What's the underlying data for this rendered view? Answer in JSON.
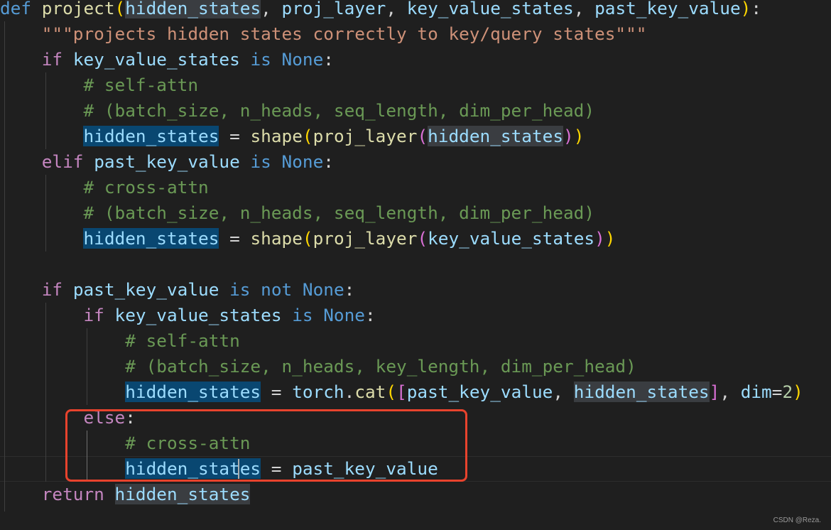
{
  "colors": {
    "background": "#1f1f1f",
    "keyword": "#c586c0",
    "storage": "#569cd6",
    "function": "#dcdcaa",
    "variable": "#9cdcfe",
    "string": "#ce9178",
    "comment": "#6a9955",
    "number": "#b5cea8",
    "plain": "#d4d4d4",
    "bracket1": "#ffd700",
    "bracket2": "#da70d6",
    "annotation_box": "#e8432d",
    "word_highlight": "#094771",
    "bracket_match_highlight": "#3a3d41"
  },
  "code": {
    "lines": [
      [
        {
          "t": "def",
          "c": "storage"
        },
        {
          "t": " ",
          "c": "plain"
        },
        {
          "t": "project",
          "c": "function"
        },
        {
          "t": "(",
          "c": "bracket1"
        },
        {
          "t": "hidden_states",
          "c": "variable",
          "hl": "match"
        },
        {
          "t": ", ",
          "c": "plain"
        },
        {
          "t": "proj_layer",
          "c": "variable"
        },
        {
          "t": ", ",
          "c": "plain"
        },
        {
          "t": "key_value_states",
          "c": "variable"
        },
        {
          "t": ", ",
          "c": "plain"
        },
        {
          "t": "past_key_value",
          "c": "variable"
        },
        {
          "t": ")",
          "c": "bracket1"
        },
        {
          "t": ":",
          "c": "plain"
        }
      ],
      [
        {
          "t": "    ",
          "c": "plain"
        },
        {
          "t": "\"\"\"projects hidden states correctly to key/query states\"\"\"",
          "c": "string"
        }
      ],
      [
        {
          "t": "    ",
          "c": "plain"
        },
        {
          "t": "if",
          "c": "keyword"
        },
        {
          "t": " ",
          "c": "plain"
        },
        {
          "t": "key_value_states",
          "c": "variable"
        },
        {
          "t": " ",
          "c": "plain"
        },
        {
          "t": "is",
          "c": "storage"
        },
        {
          "t": " ",
          "c": "plain"
        },
        {
          "t": "None",
          "c": "storage"
        },
        {
          "t": ":",
          "c": "plain"
        }
      ],
      [
        {
          "t": "        ",
          "c": "plain"
        },
        {
          "t": "# self-attn",
          "c": "comment"
        }
      ],
      [
        {
          "t": "        ",
          "c": "plain"
        },
        {
          "t": "# (batch_size, n_heads, seq_length, dim_per_head)",
          "c": "comment"
        }
      ],
      [
        {
          "t": "        ",
          "c": "plain"
        },
        {
          "t": "hidden_states",
          "c": "variable",
          "hl": "word"
        },
        {
          "t": " = ",
          "c": "plain"
        },
        {
          "t": "shape",
          "c": "function"
        },
        {
          "t": "(",
          "c": "bracket1"
        },
        {
          "t": "proj_layer",
          "c": "function"
        },
        {
          "t": "(",
          "c": "bracket2"
        },
        {
          "t": "hidden_states",
          "c": "variable",
          "hl": "match"
        },
        {
          "t": ")",
          "c": "bracket2"
        },
        {
          "t": ")",
          "c": "bracket1"
        }
      ],
      [
        {
          "t": "    ",
          "c": "plain"
        },
        {
          "t": "elif",
          "c": "keyword"
        },
        {
          "t": " ",
          "c": "plain"
        },
        {
          "t": "past_key_value",
          "c": "variable"
        },
        {
          "t": " ",
          "c": "plain"
        },
        {
          "t": "is",
          "c": "storage"
        },
        {
          "t": " ",
          "c": "plain"
        },
        {
          "t": "None",
          "c": "storage"
        },
        {
          "t": ":",
          "c": "plain"
        }
      ],
      [
        {
          "t": "        ",
          "c": "plain"
        },
        {
          "t": "# cross-attn",
          "c": "comment"
        }
      ],
      [
        {
          "t": "        ",
          "c": "plain"
        },
        {
          "t": "# (batch_size, n_heads, seq_length, dim_per_head)",
          "c": "comment"
        }
      ],
      [
        {
          "t": "        ",
          "c": "plain"
        },
        {
          "t": "hidden_states",
          "c": "variable",
          "hl": "word"
        },
        {
          "t": " = ",
          "c": "plain"
        },
        {
          "t": "shape",
          "c": "function"
        },
        {
          "t": "(",
          "c": "bracket1"
        },
        {
          "t": "proj_layer",
          "c": "function"
        },
        {
          "t": "(",
          "c": "bracket2"
        },
        {
          "t": "key_value_states",
          "c": "variable"
        },
        {
          "t": ")",
          "c": "bracket2"
        },
        {
          "t": ")",
          "c": "bracket1"
        }
      ],
      [],
      [
        {
          "t": "    ",
          "c": "plain"
        },
        {
          "t": "if",
          "c": "keyword"
        },
        {
          "t": " ",
          "c": "plain"
        },
        {
          "t": "past_key_value",
          "c": "variable"
        },
        {
          "t": " ",
          "c": "plain"
        },
        {
          "t": "is",
          "c": "storage"
        },
        {
          "t": " ",
          "c": "plain"
        },
        {
          "t": "not",
          "c": "storage"
        },
        {
          "t": " ",
          "c": "plain"
        },
        {
          "t": "None",
          "c": "storage"
        },
        {
          "t": ":",
          "c": "plain"
        }
      ],
      [
        {
          "t": "        ",
          "c": "plain"
        },
        {
          "t": "if",
          "c": "keyword"
        },
        {
          "t": " ",
          "c": "plain"
        },
        {
          "t": "key_value_states",
          "c": "variable"
        },
        {
          "t": " ",
          "c": "plain"
        },
        {
          "t": "is",
          "c": "storage"
        },
        {
          "t": " ",
          "c": "plain"
        },
        {
          "t": "None",
          "c": "storage"
        },
        {
          "t": ":",
          "c": "plain"
        }
      ],
      [
        {
          "t": "            ",
          "c": "plain"
        },
        {
          "t": "# self-attn",
          "c": "comment"
        }
      ],
      [
        {
          "t": "            ",
          "c": "plain"
        },
        {
          "t": "# (batch_size, n_heads, key_length, dim_per_head)",
          "c": "comment"
        }
      ],
      [
        {
          "t": "            ",
          "c": "plain"
        },
        {
          "t": "hidden_states",
          "c": "variable",
          "hl": "word"
        },
        {
          "t": " = ",
          "c": "plain"
        },
        {
          "t": "torch",
          "c": "variable"
        },
        {
          "t": ".",
          "c": "plain"
        },
        {
          "t": "cat",
          "c": "function"
        },
        {
          "t": "(",
          "c": "bracket1"
        },
        {
          "t": "[",
          "c": "bracket2"
        },
        {
          "t": "past_key_value",
          "c": "variable"
        },
        {
          "t": ", ",
          "c": "plain"
        },
        {
          "t": "hidden_states",
          "c": "variable",
          "hl": "match"
        },
        {
          "t": "]",
          "c": "bracket2"
        },
        {
          "t": ", ",
          "c": "plain"
        },
        {
          "t": "dim",
          "c": "variable"
        },
        {
          "t": "=",
          "c": "plain"
        },
        {
          "t": "2",
          "c": "number"
        },
        {
          "t": ")",
          "c": "bracket1"
        }
      ],
      [
        {
          "t": "        ",
          "c": "plain"
        },
        {
          "t": "else",
          "c": "keyword"
        },
        {
          "t": ":",
          "c": "plain"
        }
      ],
      [
        {
          "t": "            ",
          "c": "plain"
        },
        {
          "t": "# cross-attn",
          "c": "comment"
        }
      ],
      [
        {
          "t": "            ",
          "c": "plain"
        },
        {
          "t": "hidden_states",
          "c": "variable",
          "hl": "word"
        },
        {
          "t": " = ",
          "c": "plain"
        },
        {
          "t": "past_key_value",
          "c": "variable"
        }
      ],
      [
        {
          "t": "    ",
          "c": "plain"
        },
        {
          "t": "return",
          "c": "keyword"
        },
        {
          "t": " ",
          "c": "plain"
        },
        {
          "t": "hidden_states",
          "c": "variable",
          "hl": "match"
        }
      ]
    ]
  },
  "watermark": "CSDN @Reza."
}
